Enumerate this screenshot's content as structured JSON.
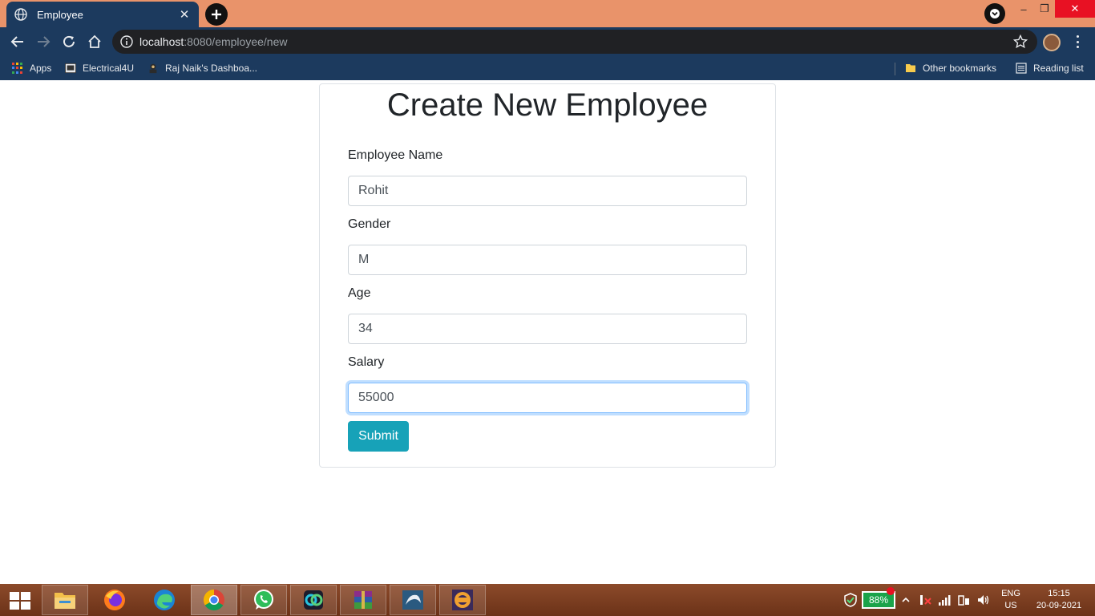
{
  "browser": {
    "tab_title": "Employee",
    "tab_close": "✕",
    "new_tab": "+",
    "window_controls": {
      "minimize": "–",
      "maximize": "❐",
      "close": "✕"
    },
    "url_host": "localhost",
    "url_path": ":8080/employee/new",
    "bookmarks": {
      "apps": "Apps",
      "electrical": "Electrical4U",
      "dashboard": "Raj Naik's Dashboa...",
      "other": "Other bookmarks",
      "reading_list": "Reading list"
    },
    "theme_color": "#1c3a5e",
    "tabstrip_color": "#e9936a"
  },
  "form": {
    "title": "Create New Employee",
    "fields": {
      "name": {
        "label": "Employee Name",
        "value": "Rohit"
      },
      "gender": {
        "label": "Gender",
        "value": "M"
      },
      "age": {
        "label": "Age",
        "value": "34"
      },
      "salary": {
        "label": "Salary",
        "value": "55000"
      }
    },
    "submit_label": "Submit",
    "submit_color": "#17a2b8",
    "focus_color": "#80bdff"
  },
  "taskbar": {
    "apps": [
      "file-explorer-icon",
      "firefox-icon",
      "edge-icon",
      "chrome-icon",
      "whatsapp-icon",
      "app-icon",
      "winrar-icon",
      "mysql-icon",
      "eclipse-javaee-icon"
    ],
    "battery": "88%",
    "lang_top": "ENG",
    "lang_bottom": "US",
    "time": "15:15",
    "date": "20-09-2021"
  }
}
